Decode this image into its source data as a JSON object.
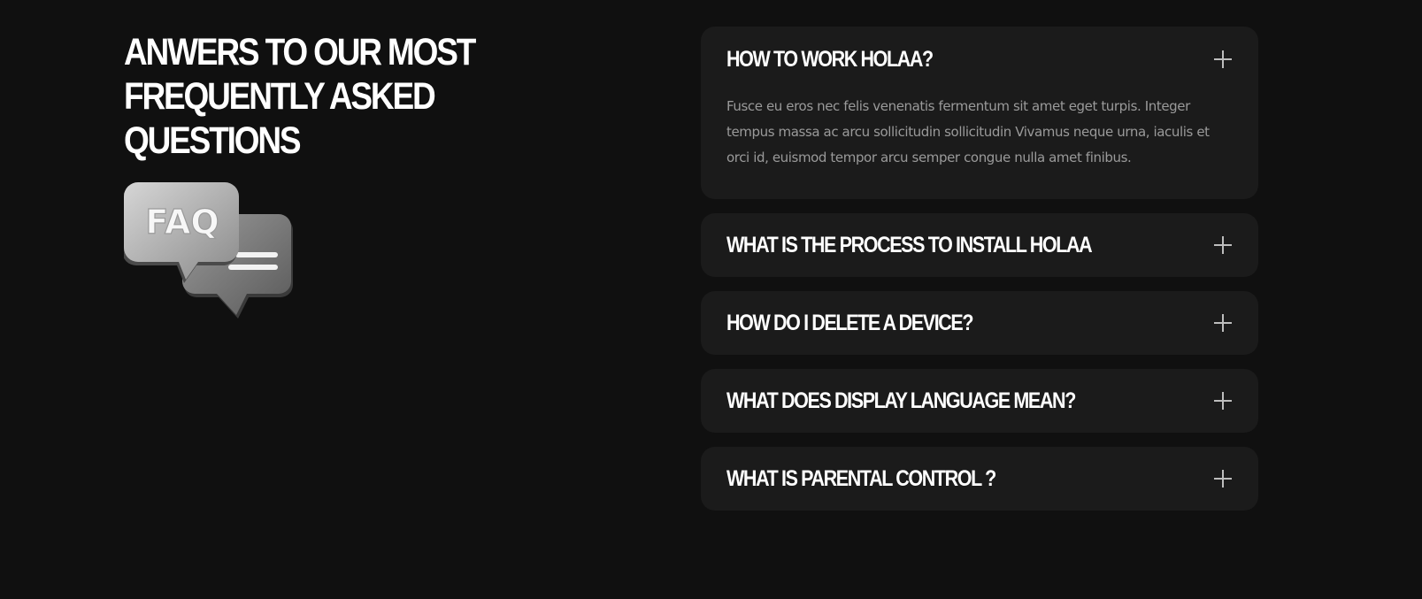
{
  "section": {
    "heading_lines": [
      "ANWERS TO OUR MOST",
      "FREQUENTLY ASKED",
      "QUESTIONS"
    ],
    "illustration": {
      "icon": "faq-chat-bubbles-icon",
      "label": "FAQ"
    }
  },
  "faq": {
    "items": [
      {
        "question": "HOW TO WORK HOLAA?",
        "answer": "Fusce eu eros nec felis venenatis fermentum sit amet eget turpis. Integer tempus massa ac arcu sollicitudin sollicitudin Vivamus neque urna, iaculis et orci id, euismod tempor arcu semper congue nulla amet finibus.",
        "open": true,
        "toggle_icon": "plus-icon"
      },
      {
        "question": "WHAT IS THE PROCESS TO INSTALL HOLAA",
        "open": false,
        "toggle_icon": "plus-icon"
      },
      {
        "question": "HOW DO I DELETE A DEVICE?",
        "open": false,
        "toggle_icon": "plus-icon"
      },
      {
        "question": "WHAT DOES DISPLAY LANGUAGE MEAN?",
        "open": false,
        "toggle_icon": "plus-icon"
      },
      {
        "question": "WHAT IS PARENTAL CONTROL ?",
        "open": false,
        "toggle_icon": "plus-icon"
      }
    ]
  },
  "colors": {
    "background": "#101010",
    "card": "#1b1b1b",
    "heading": "#ffffff",
    "answer_text": "#9a9a9a"
  }
}
